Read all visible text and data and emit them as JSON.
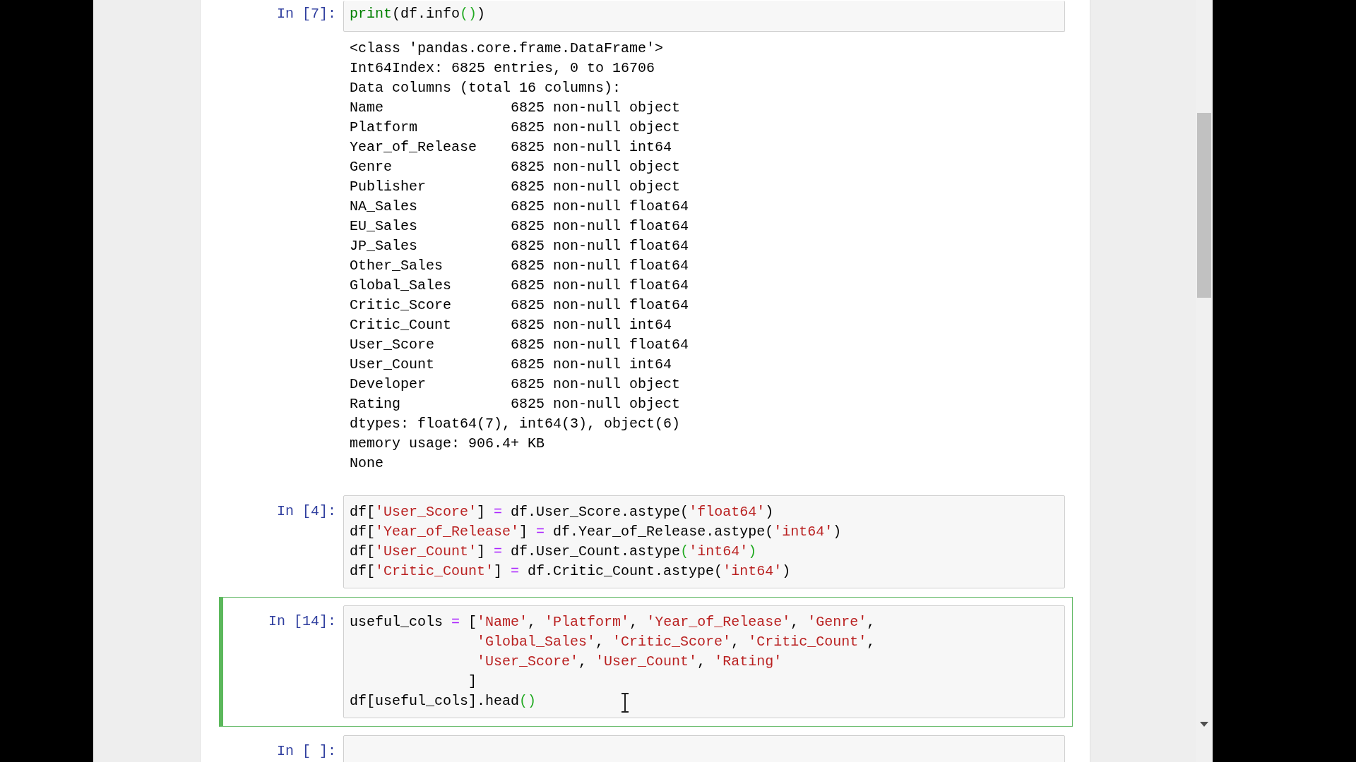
{
  "cells": [
    {
      "prompt": "In [7]:",
      "selected": false,
      "lines": [
        [
          {
            "kind": "builtin",
            "text": "print"
          },
          {
            "kind": "plain",
            "text": "(df.info"
          },
          {
            "kind": "match",
            "text": "()"
          },
          {
            "kind": "plain",
            "text": ")"
          }
        ]
      ],
      "output": [
        "<class 'pandas.core.frame.DataFrame'>",
        "Int64Index: 6825 entries, 0 to 16706",
        "Data columns (total 16 columns):",
        "Name               6825 non-null object",
        "Platform           6825 non-null object",
        "Year_of_Release    6825 non-null int64",
        "Genre              6825 non-null object",
        "Publisher          6825 non-null object",
        "NA_Sales           6825 non-null float64",
        "EU_Sales           6825 non-null float64",
        "JP_Sales           6825 non-null float64",
        "Other_Sales        6825 non-null float64",
        "Global_Sales       6825 non-null float64",
        "Critic_Score       6825 non-null float64",
        "Critic_Count       6825 non-null int64",
        "User_Score         6825 non-null float64",
        "User_Count         6825 non-null int64",
        "Developer          6825 non-null object",
        "Rating             6825 non-null object",
        "dtypes: float64(7), int64(3), object(6)",
        "memory usage: 906.4+ KB",
        "None"
      ]
    },
    {
      "prompt": "In [4]:",
      "selected": false,
      "lines": [
        [
          {
            "kind": "plain",
            "text": "df["
          },
          {
            "kind": "string",
            "text": "'User_Score'"
          },
          {
            "kind": "plain",
            "text": "] "
          },
          {
            "kind": "operator",
            "text": "="
          },
          {
            "kind": "plain",
            "text": " df.User_Score.astype("
          },
          {
            "kind": "string",
            "text": "'float64'"
          },
          {
            "kind": "plain",
            "text": ")"
          }
        ],
        [
          {
            "kind": "plain",
            "text": "df["
          },
          {
            "kind": "string",
            "text": "'Year_of_Release'"
          },
          {
            "kind": "plain",
            "text": "] "
          },
          {
            "kind": "operator",
            "text": "="
          },
          {
            "kind": "plain",
            "text": " df.Year_of_Release.astype("
          },
          {
            "kind": "string",
            "text": "'int64'"
          },
          {
            "kind": "plain",
            "text": ")"
          }
        ],
        [
          {
            "kind": "plain",
            "text": "df["
          },
          {
            "kind": "string",
            "text": "'User_Count'"
          },
          {
            "kind": "plain",
            "text": "] "
          },
          {
            "kind": "operator",
            "text": "="
          },
          {
            "kind": "plain",
            "text": " df.User_Count.astype"
          },
          {
            "kind": "match",
            "text": "("
          },
          {
            "kind": "string",
            "text": "'int64'"
          },
          {
            "kind": "match",
            "text": ")"
          }
        ],
        [
          {
            "kind": "plain",
            "text": "df["
          },
          {
            "kind": "string",
            "text": "'Critic_Count'"
          },
          {
            "kind": "plain",
            "text": "] "
          },
          {
            "kind": "operator",
            "text": "="
          },
          {
            "kind": "plain",
            "text": " df.Critic_Count.astype("
          },
          {
            "kind": "string",
            "text": "'int64'"
          },
          {
            "kind": "plain",
            "text": ")"
          }
        ]
      ]
    },
    {
      "prompt": "In [14]:",
      "selected": true,
      "lines": [
        [
          {
            "kind": "plain",
            "text": "useful_cols "
          },
          {
            "kind": "operator",
            "text": "="
          },
          {
            "kind": "plain",
            "text": " ["
          },
          {
            "kind": "string",
            "text": "'Name'"
          },
          {
            "kind": "plain",
            "text": ", "
          },
          {
            "kind": "string",
            "text": "'Platform'"
          },
          {
            "kind": "plain",
            "text": ", "
          },
          {
            "kind": "string",
            "text": "'Year_of_Release'"
          },
          {
            "kind": "plain",
            "text": ", "
          },
          {
            "kind": "string",
            "text": "'Genre'"
          },
          {
            "kind": "plain",
            "text": ","
          }
        ],
        [
          {
            "kind": "string",
            "text": "               'Global_Sales'"
          },
          {
            "kind": "plain",
            "text": ", "
          },
          {
            "kind": "string",
            "text": "'Critic_Score'"
          },
          {
            "kind": "plain",
            "text": ", "
          },
          {
            "kind": "string",
            "text": "'Critic_Count'"
          },
          {
            "kind": "plain",
            "text": ","
          }
        ],
        [
          {
            "kind": "string",
            "text": "               'User_Score'"
          },
          {
            "kind": "plain",
            "text": ", "
          },
          {
            "kind": "string",
            "text": "'User_Count'"
          },
          {
            "kind": "plain",
            "text": ", "
          },
          {
            "kind": "string",
            "text": "'Rating'"
          }
        ],
        [
          {
            "kind": "plain",
            "text": "              ]"
          }
        ],
        [
          {
            "kind": "plain",
            "text": "df[useful_cols].head"
          },
          {
            "kind": "match",
            "text": "()"
          }
        ]
      ]
    },
    {
      "prompt": "In [ ]:",
      "selected": false
    }
  ]
}
